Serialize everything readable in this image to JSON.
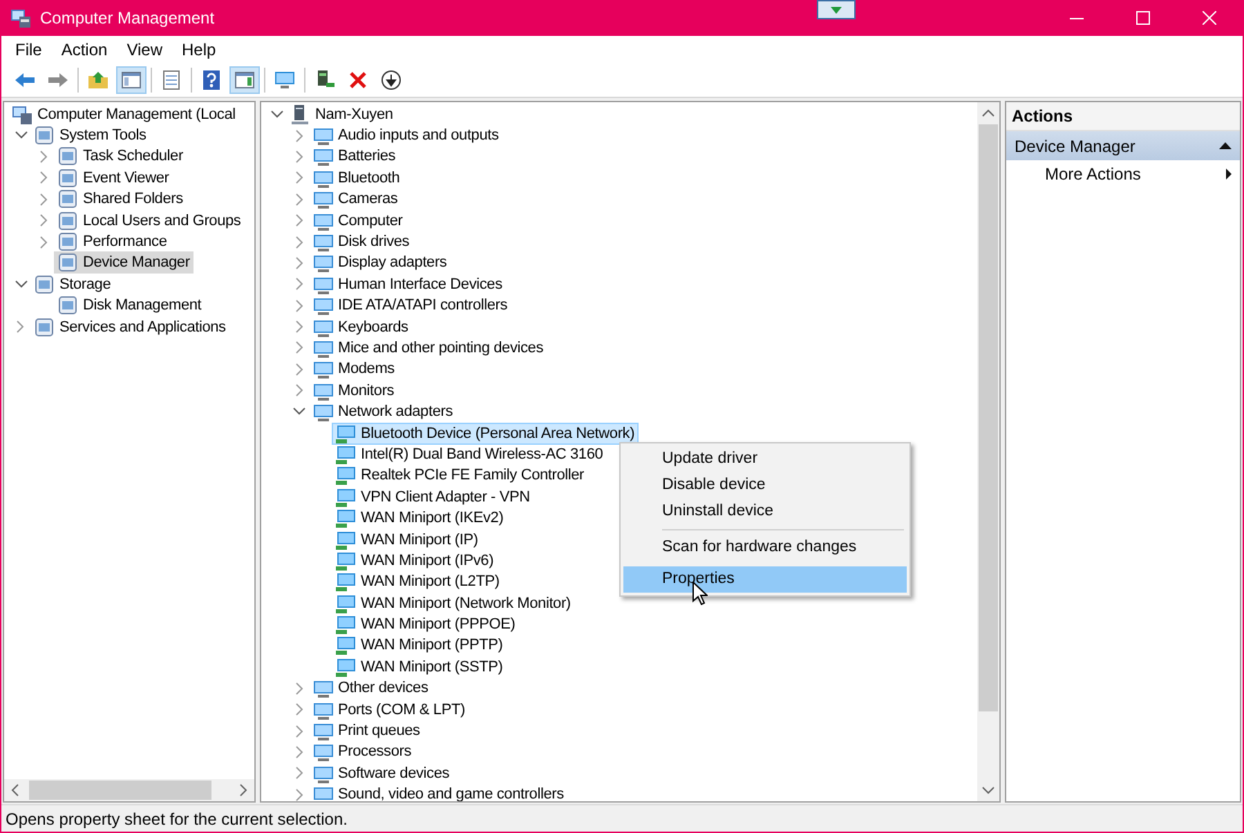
{
  "window": {
    "title": "Computer Management"
  },
  "menu": [
    "File",
    "Action",
    "View",
    "Help"
  ],
  "toolbar": [
    [
      {
        "kind": "back",
        "pressed": false
      },
      {
        "kind": "forward",
        "pressed": false
      }
    ],
    [
      {
        "kind": "up",
        "pressed": false
      },
      {
        "kind": "tree",
        "pressed": true
      }
    ],
    [
      {
        "kind": "export",
        "pressed": false
      }
    ],
    [
      {
        "kind": "help",
        "pressed": false
      },
      {
        "kind": "pane",
        "pressed": true
      }
    ],
    [
      {
        "kind": "monitor",
        "pressed": false
      }
    ],
    [
      {
        "kind": "update",
        "pressed": false
      },
      {
        "kind": "delete",
        "pressed": false
      },
      {
        "kind": "download",
        "pressed": false
      }
    ]
  ],
  "console_tree": [
    {
      "label": "Computer Management (Local",
      "selected": false,
      "children": [
        {
          "label": "System Tools",
          "expanded": true,
          "selected": false,
          "children": [
            {
              "label": "Task Scheduler",
              "expanded": false,
              "selected": false
            },
            {
              "label": "Event Viewer",
              "expanded": false,
              "selected": false
            },
            {
              "label": "Shared Folders",
              "expanded": false,
              "selected": false
            },
            {
              "label": "Local Users and Groups",
              "expanded": false,
              "selected": false
            },
            {
              "label": "Performance",
              "expanded": false,
              "selected": false
            },
            {
              "label": "Device Manager",
              "selected": true
            }
          ]
        },
        {
          "label": "Storage",
          "expanded": true,
          "selected": false,
          "children": [
            {
              "label": "Disk Management",
              "selected": false
            }
          ]
        },
        {
          "label": "Services and Applications",
          "expanded": false,
          "selected": false
        }
      ]
    }
  ],
  "device_tree": [
    {
      "label": "Nam-Xuyen",
      "expanded": true,
      "selected": false,
      "children": [
        {
          "label": "Audio inputs and outputs",
          "expanded": false,
          "selected": false
        },
        {
          "label": "Batteries",
          "expanded": false,
          "selected": false
        },
        {
          "label": "Bluetooth",
          "expanded": false,
          "selected": false
        },
        {
          "label": "Cameras",
          "expanded": false,
          "selected": false
        },
        {
          "label": "Computer",
          "expanded": false,
          "selected": false
        },
        {
          "label": "Disk drives",
          "expanded": false,
          "selected": false
        },
        {
          "label": "Display adapters",
          "expanded": false,
          "selected": false
        },
        {
          "label": "Human Interface Devices",
          "expanded": false,
          "selected": false
        },
        {
          "label": "IDE ATA/ATAPI controllers",
          "expanded": false,
          "selected": false
        },
        {
          "label": "Keyboards",
          "expanded": false,
          "selected": false
        },
        {
          "label": "Mice and other pointing devices",
          "expanded": false,
          "selected": false
        },
        {
          "label": "Modems",
          "expanded": false,
          "selected": false
        },
        {
          "label": "Monitors",
          "expanded": false,
          "selected": false
        },
        {
          "label": "Network adapters",
          "expanded": true,
          "selected": false,
          "children": [
            {
              "label": "Bluetooth Device (Personal Area Network)",
              "selected": true
            },
            {
              "label": "Intel(R) Dual Band Wireless-AC 3160",
              "selected": false
            },
            {
              "label": "Realtek PCIe FE Family Controller",
              "selected": false
            },
            {
              "label": "VPN Client Adapter - VPN",
              "selected": false
            },
            {
              "label": "WAN Miniport (IKEv2)",
              "selected": false
            },
            {
              "label": "WAN Miniport (IP)",
              "selected": false
            },
            {
              "label": "WAN Miniport (IPv6)",
              "selected": false
            },
            {
              "label": "WAN Miniport (L2TP)",
              "selected": false
            },
            {
              "label": "WAN Miniport (Network Monitor)",
              "selected": false
            },
            {
              "label": "WAN Miniport (PPPOE)",
              "selected": false
            },
            {
              "label": "WAN Miniport (PPTP)",
              "selected": false
            },
            {
              "label": "WAN Miniport (SSTP)",
              "selected": false
            }
          ]
        },
        {
          "label": "Other devices",
          "expanded": false,
          "selected": false
        },
        {
          "label": "Ports (COM & LPT)",
          "expanded": false,
          "selected": false
        },
        {
          "label": "Print queues",
          "expanded": false,
          "selected": false
        },
        {
          "label": "Processors",
          "expanded": false,
          "selected": false
        },
        {
          "label": "Software devices",
          "expanded": false,
          "selected": false
        },
        {
          "label": "Sound, video and game controllers",
          "expanded": false,
          "selected": false
        }
      ]
    }
  ],
  "context_menu": [
    {
      "kind": "item",
      "label": "Update driver",
      "selected": false
    },
    {
      "kind": "item",
      "label": "Disable device",
      "selected": false
    },
    {
      "kind": "item",
      "label": "Uninstall device",
      "selected": false
    },
    {
      "kind": "separator"
    },
    {
      "kind": "item",
      "label": "Scan for hardware changes",
      "selected": false
    },
    {
      "kind": "item",
      "label": "Properties",
      "selected": true
    }
  ],
  "actions": {
    "header": "Actions",
    "sections": [
      {
        "title": "Device Manager",
        "expanded": true,
        "items": [
          "More Actions"
        ]
      }
    ]
  },
  "status_bar": "Opens property sheet for the current selection."
}
